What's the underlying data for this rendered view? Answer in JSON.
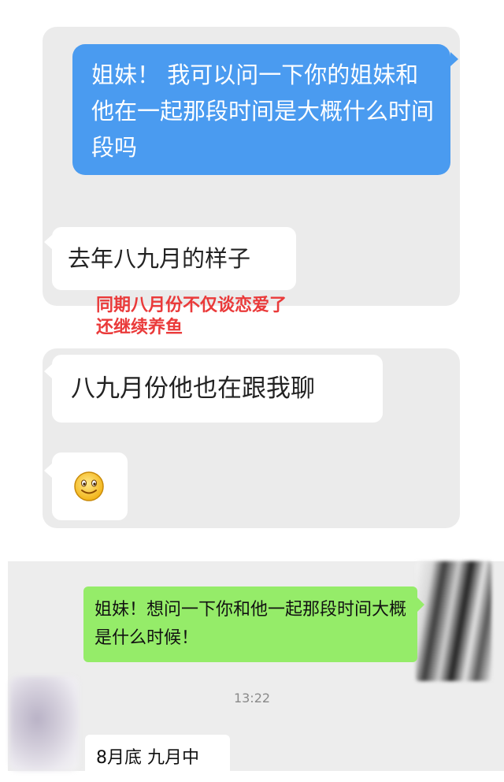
{
  "chat1": {
    "sent_message": "姐妹！ 我可以问一下你的姐妹和他在一起那段时间是大概什么时间段吗",
    "reply_1": "去年八九月的样子",
    "annotation": "同期八月份不仅谈恋爱了\n还继续养鱼",
    "reply_2": "八九月份他也在跟我聊",
    "reply_3_emoji": "smile-emoji"
  },
  "chat2": {
    "sent_message": "姐妹！想问一下你和他一起那段时间大概是什么时候！",
    "timestamp": "13:22",
    "reply_1": "8月底 九月中"
  },
  "colors": {
    "blue_bubble": "#4a9bf0",
    "green_bubble": "#95ec69",
    "annotation_red": "#ea3a3a",
    "panel_gray": "#ebebeb"
  }
}
